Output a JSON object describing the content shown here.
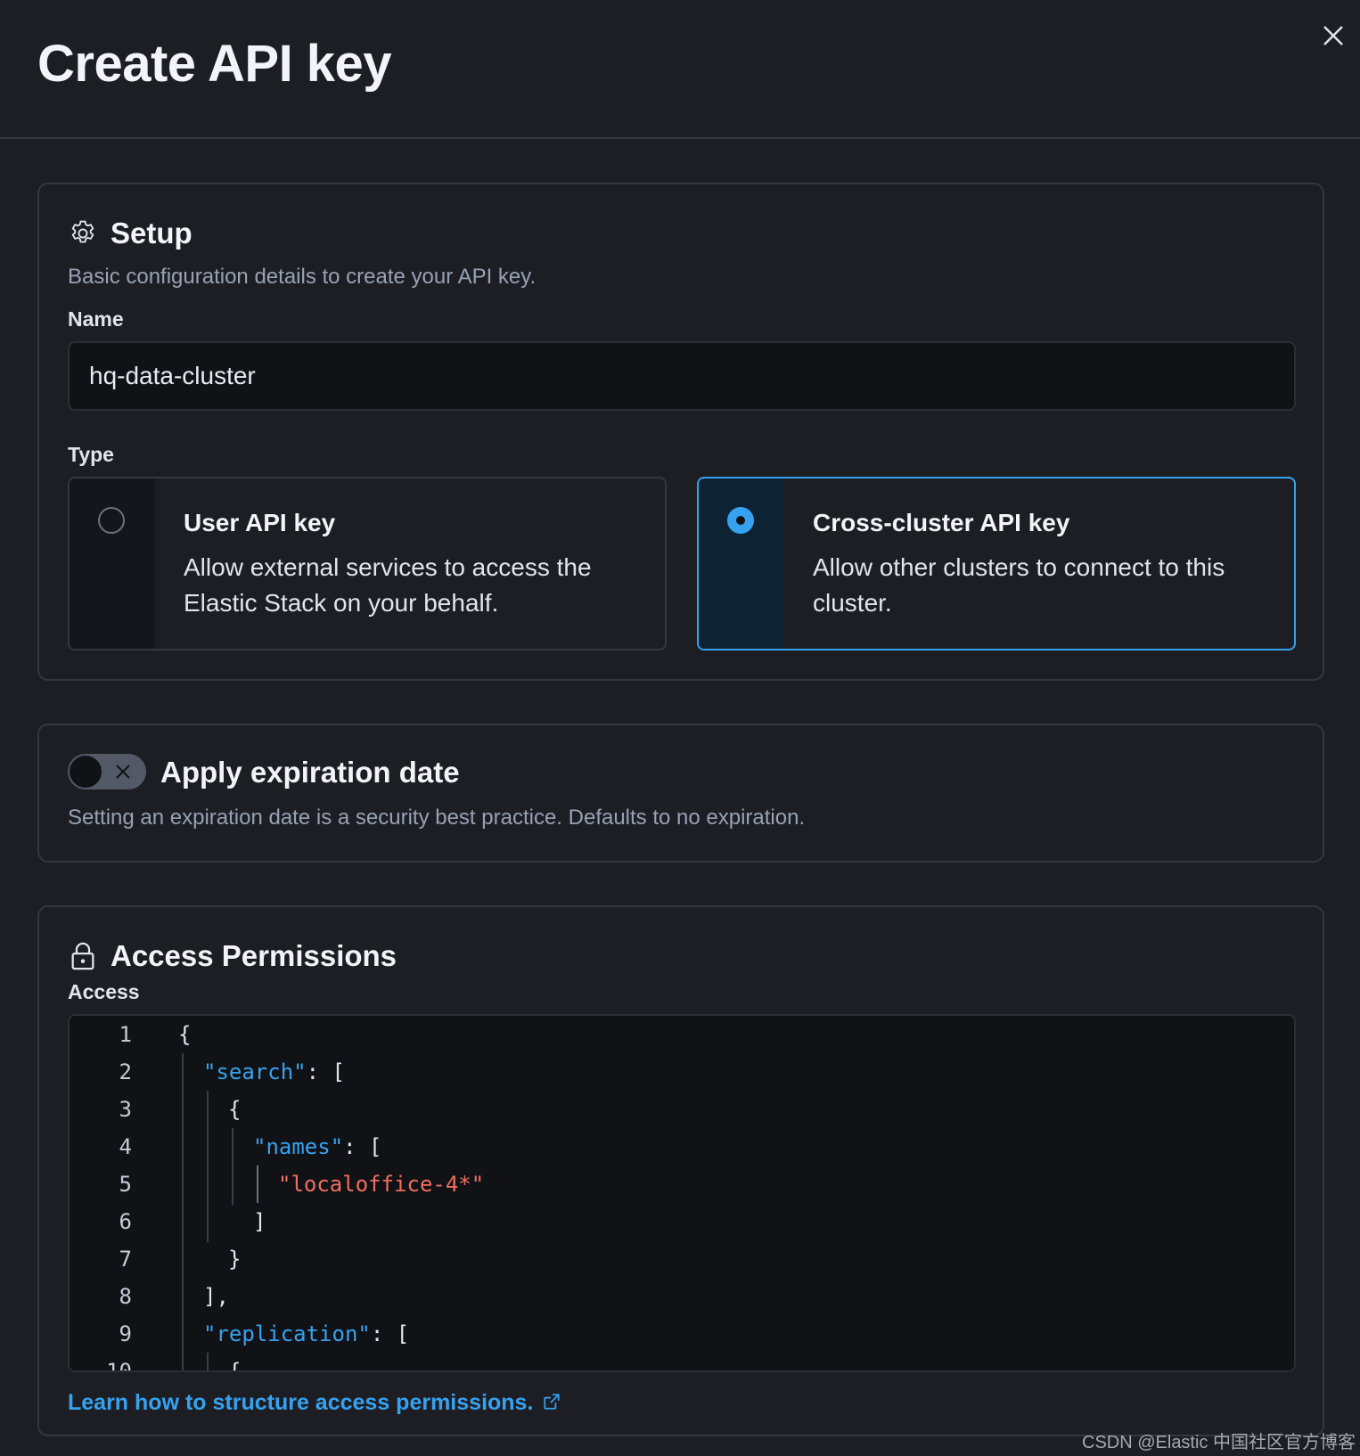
{
  "header": {
    "title": "Create API key",
    "close_icon": "close-icon"
  },
  "setup": {
    "icon": "gear-icon",
    "title": "Setup",
    "description": "Basic configuration details to create your API key.",
    "name_label": "Name",
    "name_value": "hq-data-cluster",
    "type_label": "Type",
    "type_options": [
      {
        "title": "User API key",
        "description": "Allow external services to access the Elastic Stack on your behalf.",
        "selected": false
      },
      {
        "title": "Cross-cluster API key",
        "description": "Allow other clusters to connect to this cluster.",
        "selected": true
      }
    ]
  },
  "expiration": {
    "toggle_state": "off",
    "title": "Apply expiration date",
    "description": "Setting an expiration date is a security best practice. Defaults to no expiration."
  },
  "access": {
    "icon": "lock-icon",
    "title": "Access Permissions",
    "label": "Access",
    "code_lines": [
      {
        "num": "1",
        "tokens": [
          {
            "t": "p",
            "v": "{"
          }
        ]
      },
      {
        "num": "2",
        "tokens": [
          {
            "t": "key",
            "v": "\"search\""
          },
          {
            "t": "p",
            "v": ": ["
          }
        ]
      },
      {
        "num": "3",
        "tokens": [
          {
            "t": "p",
            "v": "{"
          }
        ]
      },
      {
        "num": "4",
        "tokens": [
          {
            "t": "key",
            "v": "\"names\""
          },
          {
            "t": "p",
            "v": ": ["
          }
        ]
      },
      {
        "num": "5",
        "tokens": [
          {
            "t": "str",
            "v": "\"localoffice-4*\""
          }
        ]
      },
      {
        "num": "6",
        "tokens": [
          {
            "t": "p",
            "v": "]"
          }
        ]
      },
      {
        "num": "7",
        "tokens": [
          {
            "t": "p",
            "v": "}"
          }
        ]
      },
      {
        "num": "8",
        "tokens": [
          {
            "t": "p",
            "v": "],"
          }
        ]
      },
      {
        "num": "9",
        "tokens": [
          {
            "t": "key",
            "v": "\"replication\""
          },
          {
            "t": "p",
            "v": ": ["
          }
        ]
      },
      {
        "num": "10",
        "tokens": [
          {
            "t": "p",
            "v": "{"
          }
        ]
      }
    ],
    "link_text": "Learn how to structure access permissions."
  },
  "watermark": "CSDN @Elastic 中国社区官方博客",
  "colors": {
    "accent": "#36a2ef",
    "string": "#f16d5f",
    "background": "#1d1e24"
  }
}
